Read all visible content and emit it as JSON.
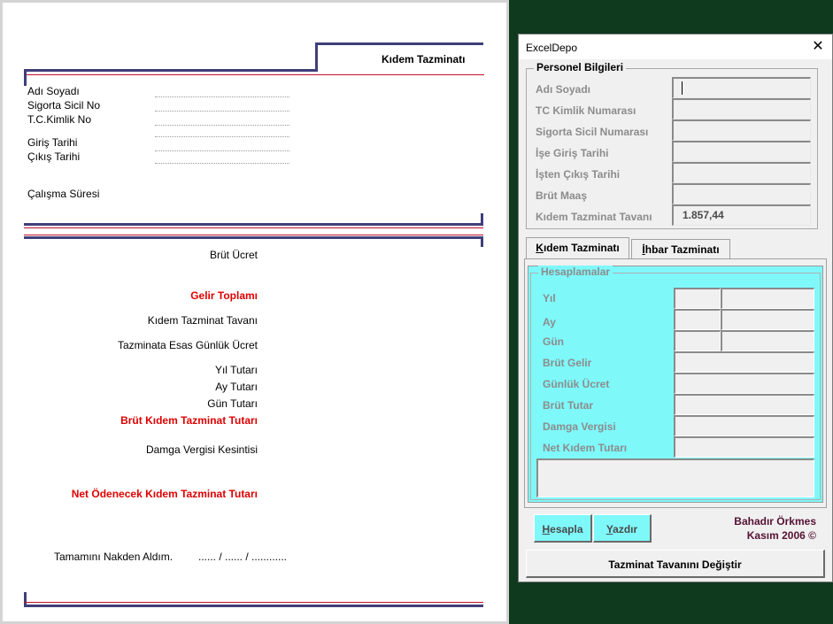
{
  "sheet": {
    "header_title": "Kıdem Tazminatı",
    "labels": {
      "ad_soyadi": "Adı Soyadı",
      "sigorta_sicil_no": "Sigorta Sicil No",
      "tc_kimlik_no": "T.C.Kimlik No",
      "giris_tarihi": "Giriş Tarihi",
      "cikis_tarihi": "Çıkış Tarihi",
      "calisma_suresi": "Çalışma Süresi"
    },
    "calc_rows": {
      "brut_ucret": "Brüt Ücret",
      "gelir_toplami": "Gelir Toplamı",
      "kidem_tazminat_tavani": "Kıdem Tazminat Tavanı",
      "esas_gunluk_ucret": "Tazminata Esas Günlük Ücret",
      "yil_tutari": "Yıl Tutarı",
      "ay_tutari": "Ay Tutarı",
      "gun_tutari": "Gün Tutarı",
      "brut_kidem_tutari": "Brüt Kıdem Tazminat Tutarı",
      "damga_vergisi": "Damga Vergisi Kesintisi",
      "net_odenecek": "Net Ödenecek Kıdem Tazminat Tutarı"
    },
    "footer_text": "Tamamını Nakden Aldım.",
    "footer_date": "...... / ...... / ............"
  },
  "dialog": {
    "title": "ExcelDepo",
    "close_glyph": "✕",
    "personel_frame_title": "Personel Bilgileri",
    "fields": {
      "adi_soyadi": {
        "label": "Adı Soyadı",
        "value": ""
      },
      "tc_kimlik": {
        "label": "TC Kimlik Numarası",
        "value": ""
      },
      "sigorta_sicil": {
        "label": "Sigorta Sicil Numarası",
        "value": ""
      },
      "ise_giris": {
        "label": "İşe Giriş Tarihi",
        "value": ""
      },
      "isten_cikis": {
        "label": "İşten Çıkış Tarihi",
        "value": ""
      },
      "brut_maas": {
        "label": "Brüt Maaş",
        "value": ""
      },
      "kidem_tavani": {
        "label": "Kıdem Tazminat Tavanı",
        "value": "1.857,44"
      }
    },
    "tabs": {
      "kidem_first": "K",
      "kidem_rest": "ıdem Tazminatı",
      "ihbar_first": "İ",
      "ihbar_rest": "hbar Tazminatı"
    },
    "calc_frame_title": "Hesaplamalar",
    "calc_labels": {
      "yil": "Yıl",
      "ay": "Ay",
      "gun": "Gün",
      "brut_gelir": "Brüt Gelir",
      "gunluk_ucret": "Günlük Ücret",
      "brut_tutar": "Brüt Tutar",
      "damga_vergisi": "Damga Vergisi",
      "net_kidem": "Net Kıdem Tutarı"
    },
    "buttons": {
      "hesapla_first": "H",
      "hesapla_rest": "esapla",
      "yazdir_first": "Y",
      "yazdir_rest": "azdır",
      "tavan_degistir": "Tazminat Tavanını Değiştir"
    },
    "credit_name": "Bahadır Örkmes",
    "credit_date": "Kasım 2006 ©"
  },
  "colors": {
    "navy_rule": "#3f3f7a",
    "red_rule": "#c0102a",
    "red_text": "#e00000",
    "cyan_panel": "#7ff8fa",
    "credit_text": "#551133",
    "background": "#0f3a1e"
  }
}
